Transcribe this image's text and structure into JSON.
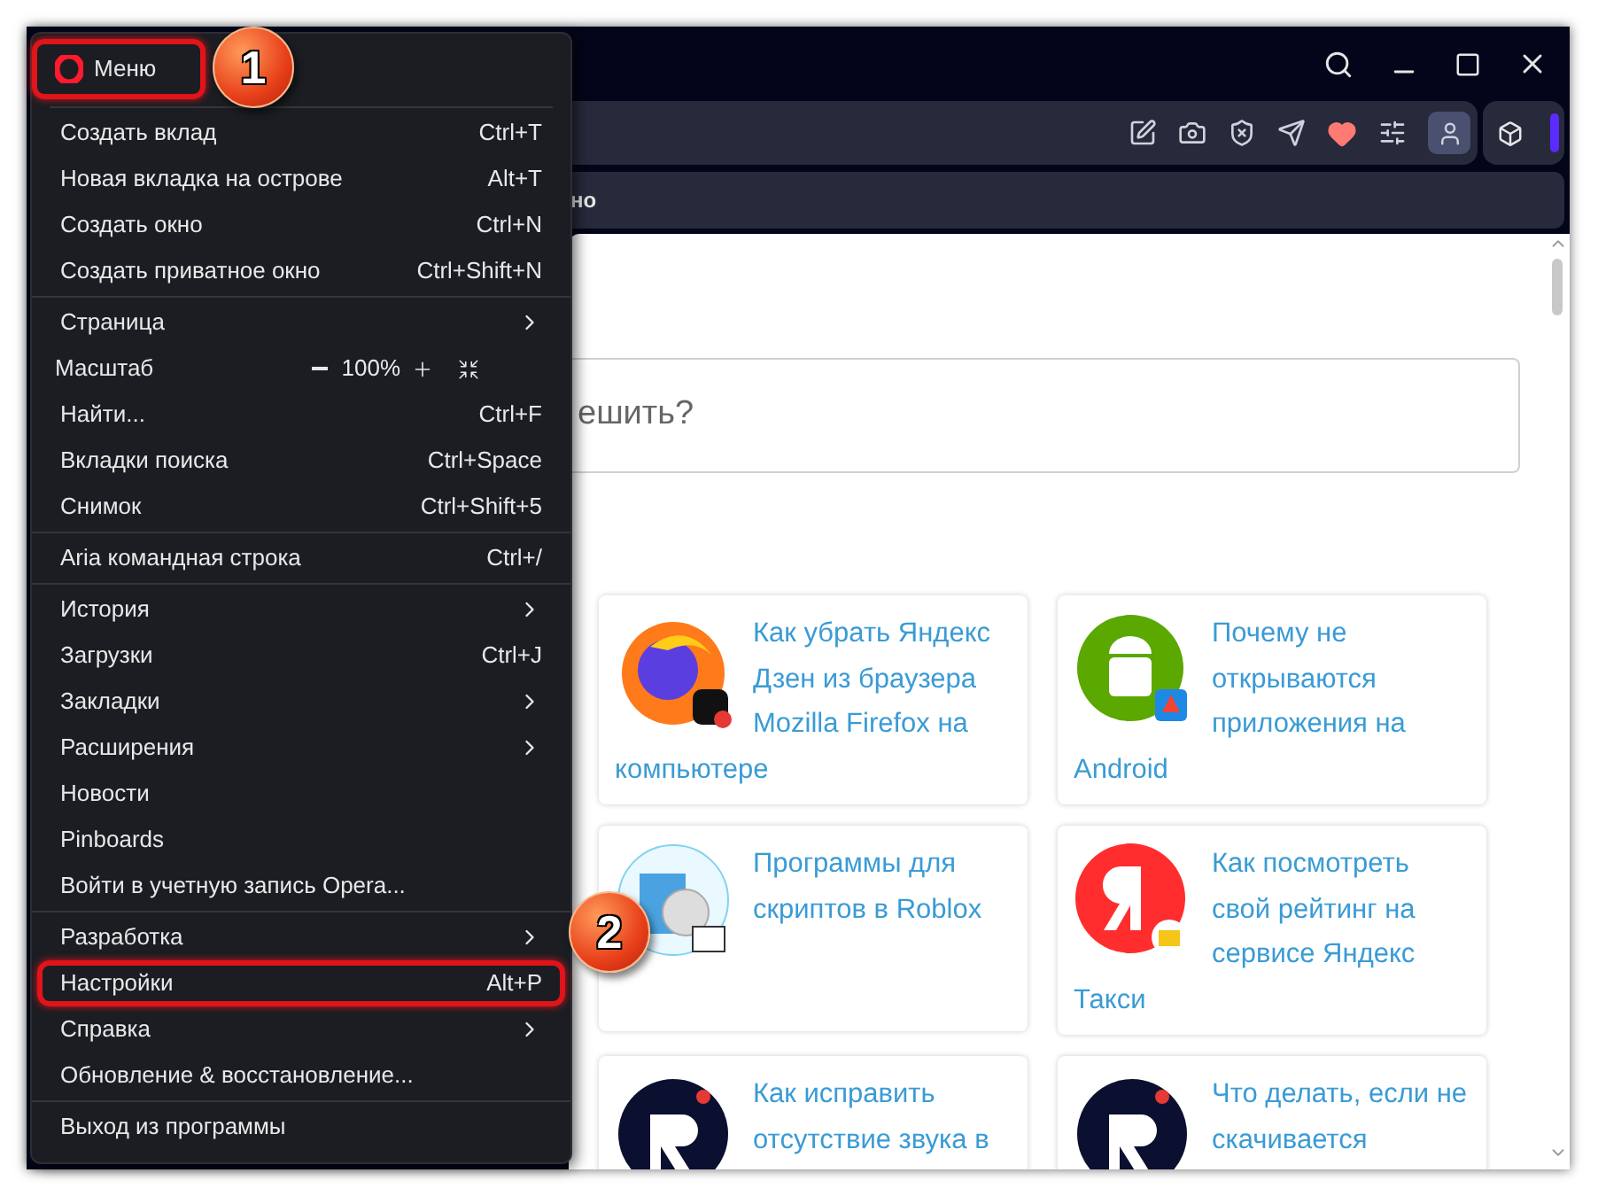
{
  "bookmarks_bar": {
    "text": "но"
  },
  "search": {
    "value": "ешить?"
  },
  "cards": [
    {
      "kind": "firefox",
      "title": "Как убрать Яндекс Дзен из браузера Mozilla Firefox на компьютере"
    },
    {
      "kind": "android",
      "title": "Почему не открываются приложения на Android"
    },
    {
      "kind": "software",
      "title": "Программы для скриптов в Roblox"
    },
    {
      "kind": "yandex",
      "title": "Как посмотреть свой рейтинг на сервисе Яндекс Такси"
    },
    {
      "kind": "r-logo",
      "title": "Как исправить отсутствие звука в"
    },
    {
      "kind": "r-logo",
      "title": "Что делать, если не скачивается"
    }
  ],
  "menu": {
    "title": "Меню",
    "highlighted": true,
    "groups": [
      {
        "items": [
          {
            "kind": "item",
            "label": "Создать вклад",
            "shortcut": "Ctrl+T",
            "submenu": false,
            "highlighted": false
          },
          {
            "kind": "item",
            "label": "Новая вкладка на острове",
            "shortcut": "Alt+T",
            "submenu": false,
            "highlighted": false
          },
          {
            "kind": "item",
            "label": "Создать окно",
            "shortcut": "Ctrl+N",
            "submenu": false,
            "highlighted": false
          },
          {
            "kind": "item",
            "label": "Создать приватное окно",
            "shortcut": "Ctrl+Shift+N",
            "submenu": false,
            "highlighted": false
          }
        ]
      },
      {
        "items": [
          {
            "kind": "item",
            "label": "Страница",
            "submenu": true,
            "highlighted": false
          },
          {
            "kind": "zoom",
            "label": "Масштаб",
            "value": "100%"
          },
          {
            "kind": "item",
            "label": "Найти...",
            "shortcut": "Ctrl+F",
            "submenu": false,
            "highlighted": false
          },
          {
            "kind": "item",
            "label": "Вкладки поиска",
            "shortcut": "Ctrl+Space",
            "submenu": false,
            "highlighted": false
          },
          {
            "kind": "item",
            "label": "Снимок",
            "shortcut": "Ctrl+Shift+5",
            "submenu": false,
            "highlighted": false
          }
        ]
      },
      {
        "items": [
          {
            "kind": "item",
            "label": "Aria командная строка",
            "shortcut": "Ctrl+/",
            "submenu": false,
            "highlighted": false
          }
        ]
      },
      {
        "items": [
          {
            "kind": "item",
            "label": "История",
            "submenu": true,
            "highlighted": false
          },
          {
            "kind": "item",
            "label": "Загрузки",
            "shortcut": "Ctrl+J",
            "submenu": false,
            "highlighted": false
          },
          {
            "kind": "item",
            "label": "Закладки",
            "submenu": true,
            "highlighted": false
          },
          {
            "kind": "item",
            "label": "Расширения",
            "submenu": true,
            "highlighted": false
          },
          {
            "kind": "item",
            "label": "Новости",
            "submenu": false,
            "highlighted": false
          },
          {
            "kind": "item",
            "label": "Pinboards",
            "submenu": false,
            "highlighted": false
          },
          {
            "kind": "item",
            "label": "Войти в учетную запись Opera...",
            "submenu": false,
            "highlighted": false
          }
        ]
      },
      {
        "items": [
          {
            "kind": "item",
            "label": "Разработка",
            "submenu": true,
            "highlighted": false
          },
          {
            "kind": "item",
            "label": "Настройки",
            "shortcut": "Alt+P",
            "submenu": false,
            "highlighted": true
          },
          {
            "kind": "item",
            "label": "Справка",
            "submenu": true,
            "highlighted": false
          },
          {
            "kind": "item",
            "label": "Обновление & восстановление...",
            "submenu": false,
            "highlighted": false
          }
        ]
      },
      {
        "items": [
          {
            "kind": "item",
            "label": "Выход из программы",
            "submenu": false,
            "highlighted": false
          }
        ]
      }
    ]
  },
  "annotations": [
    {
      "label": "1"
    },
    {
      "label": "2"
    }
  ]
}
